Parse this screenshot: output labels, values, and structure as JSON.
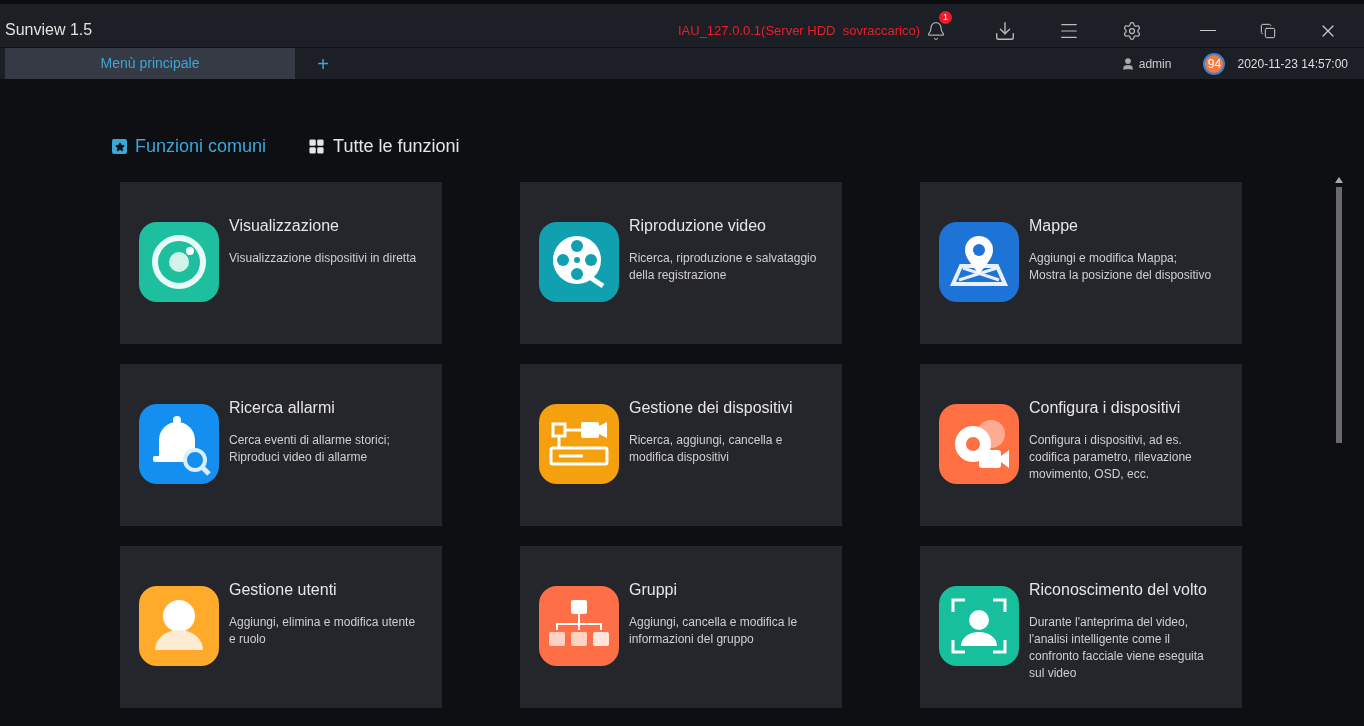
{
  "window": {
    "title": "Sunview 1.5",
    "alert": "IAU_127.0.0.1(Server HDD  sovraccarico)",
    "notification_count": "1"
  },
  "tabs": [
    {
      "label": "Menù principale",
      "selected": true
    },
    {
      "label": "+",
      "kind": "add",
      "selected": false
    }
  ],
  "status": {
    "user": "admin",
    "badge": "94",
    "datetime": "2020-11-23 14:57:00"
  },
  "sections": [
    {
      "label": "Funzioni comuni",
      "kind": "star",
      "selected": true
    },
    {
      "label": "Tutte le funzioni",
      "kind": "grid",
      "selected": false
    }
  ],
  "cards": [
    {
      "kind": "camera",
      "title": "Visualizzazione",
      "description": [
        "Visualizzazione dispositivi in diretta"
      ]
    },
    {
      "kind": "film",
      "title": "Riproduzione video",
      "description": [
        "Ricerca, riproduzione e salvataggio",
        "della registrazione"
      ]
    },
    {
      "kind": "map",
      "title": "Mappe",
      "description": [
        "Aggiungi e modifica Mappa;",
        "Mostra la posizione del dispositivo"
      ]
    },
    {
      "kind": "alarm",
      "title": "Ricerca allarmi",
      "description": [
        "Cerca eventi di allarme storici;",
        "Riproduci video di allarme"
      ]
    },
    {
      "kind": "device",
      "title": "Gestione dei dispositivi",
      "description": [
        "Ricerca, aggiungi, cancella e",
        "modifica dispositivi"
      ]
    },
    {
      "kind": "config",
      "title": "Configura i dispositivi",
      "description": [
        "Configura i dispositivi, ad es.",
        "codifica parametro, rilevazione",
        "movimento, OSD, ecc."
      ]
    },
    {
      "kind": "user",
      "title": "Gestione utenti",
      "description": [
        "Aggiungi, elimina e modifica utente",
        "e ruolo"
      ]
    },
    {
      "kind": "group",
      "title": "Gruppi",
      "description": [
        "Aggiungi, cancella e modifica le",
        "informazioni del gruppo"
      ]
    },
    {
      "kind": "face",
      "title": "Riconoscimento del volto",
      "description": [
        "Durante l'anteprima del video,",
        "l'analisi intelligente come il",
        "confronto facciale viene eseguita",
        "sul video"
      ]
    }
  ]
}
